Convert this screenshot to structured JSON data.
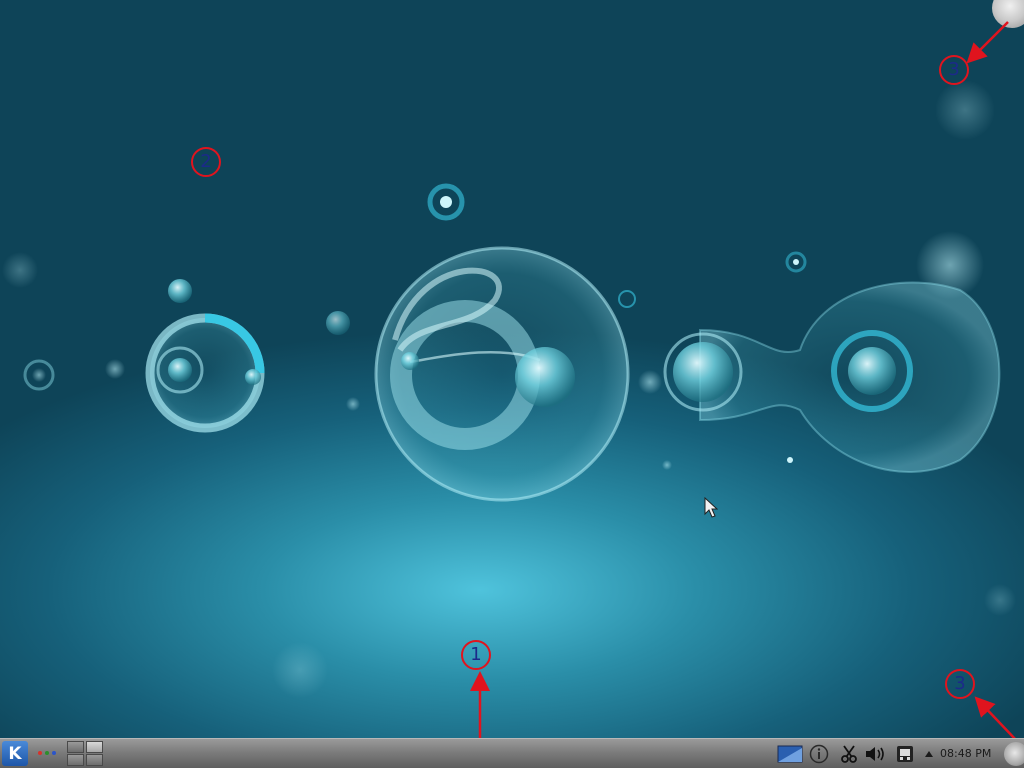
{
  "markers": {
    "panel": "1",
    "desktop": "2",
    "cashew_top": "3",
    "cashew_bottom": "3"
  },
  "panel": {
    "kickoff_letter": "K",
    "activity_dot_colors": [
      "#d9312b",
      "#2c8f2c",
      "#2b55c9"
    ],
    "pager_active_desktop": 2,
    "clock_time": "08:48 PM"
  },
  "tray_icons": [
    "screen-icon",
    "info-icon",
    "scissors-icon",
    "volume-icon",
    "network-icon",
    "expand-arrow-icon"
  ],
  "colors": {
    "marker_red": "#e0141e",
    "marker_text": "#1c2a8a",
    "wallpaper_accent": "#4fc3dc"
  }
}
